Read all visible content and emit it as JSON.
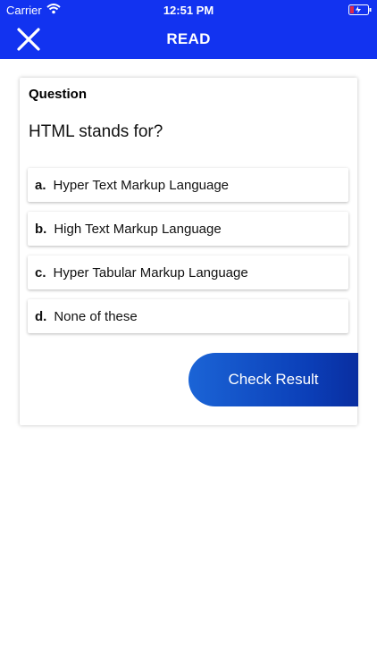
{
  "status_bar": {
    "carrier": "Carrier",
    "time": "12:51 PM"
  },
  "nav": {
    "title": "READ",
    "close_icon": "close-icon"
  },
  "question": {
    "label": "Question",
    "text": "HTML stands for?",
    "options": [
      {
        "letter": "a.",
        "text": "Hyper Text Markup Language"
      },
      {
        "letter": "b.",
        "text": "High Text Markup Language"
      },
      {
        "letter": "c.",
        "text": "Hyper Tabular Markup Language"
      },
      {
        "letter": "d.",
        "text": "None of these"
      }
    ]
  },
  "actions": {
    "check_result": "Check Result"
  },
  "colors": {
    "header_blue": "#1233f0",
    "button_blue": "#0b3fb8"
  }
}
